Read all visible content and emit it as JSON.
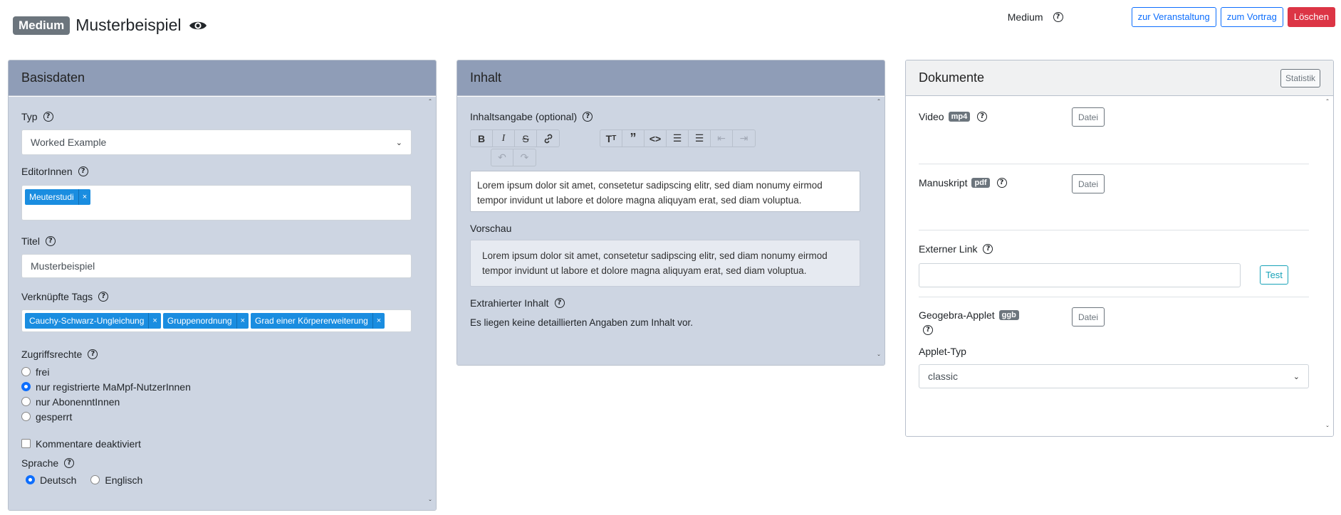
{
  "header": {
    "badge": "Medium",
    "title": "Musterbeispiel",
    "level_label": "Medium",
    "buttons": {
      "to_event": "zur Veranstaltung",
      "to_talk": "zum Vortrag",
      "delete": "Löschen"
    }
  },
  "basisdaten": {
    "title": "Basisdaten",
    "typ_label": "Typ",
    "typ_value": "Worked Example",
    "editors_label": "EditorInnen",
    "editors": [
      "Meuterstudi"
    ],
    "titel_label": "Titel",
    "titel_value": "Musterbeispiel",
    "tags_label": "Verknüpfte Tags",
    "tags": [
      "Cauchy-Schwarz-Ungleichung",
      "Gruppenordnung",
      "Grad einer Körpererweiterung"
    ],
    "access_label": "Zugriffsrechte",
    "access_options": [
      "frei",
      "nur registrierte MaMpf-NutzerInnen",
      "nur AbonenntInnen",
      "gesperrt"
    ],
    "access_selected": 1,
    "comments_label": "Kommentare deaktiviert",
    "language_label": "Sprache",
    "language_options": [
      "Deutsch",
      "Englisch"
    ],
    "language_selected": 0
  },
  "inhalt": {
    "title": "Inhalt",
    "summary_label": "Inhaltsangabe (optional)",
    "editor_text": "Lorem ipsum dolor sit amet, consetetur sadipscing elitr, sed diam nonumy eirmod tempor invidunt ut labore et dolore magna aliquyam erat, sed diam voluptua.",
    "preview_label": "Vorschau",
    "preview_text": "Lorem ipsum dolor sit amet, consetetur sadipscing elitr, sed diam nonumy eirmod tempor invidunt ut labore et dolore magna aliquyam erat, sed diam voluptua.",
    "extracted_label": "Extrahierter Inhalt",
    "extracted_text": "Es liegen keine detaillierten Angaben zum Inhalt vor."
  },
  "dokumente": {
    "title": "Dokumente",
    "stats_button": "Statistik",
    "video_label": "Video",
    "video_badge": "mp4",
    "manuscript_label": "Manuskript",
    "manuscript_badge": "pdf",
    "file_button": "Datei",
    "external_link_label": "Externer Link",
    "external_link_value": "",
    "test_button": "Test",
    "geogebra_label": "Geogebra-Applet",
    "geogebra_badge": "ggb",
    "applet_type_label": "Applet-Typ",
    "applet_type_value": "classic"
  }
}
